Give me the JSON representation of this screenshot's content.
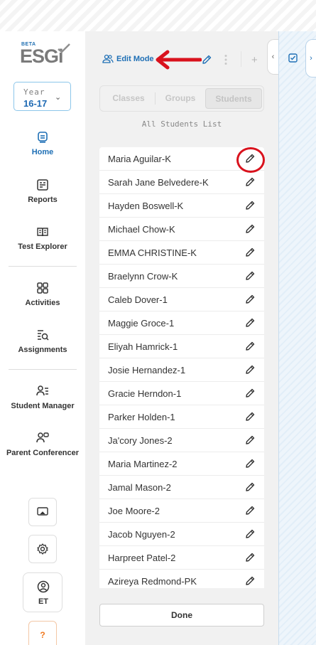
{
  "brand": {
    "beta": "BETA",
    "logo_text": "ESGi"
  },
  "year_selector": {
    "label": "Year",
    "value": "16-17"
  },
  "nav": [
    {
      "label": "Home",
      "icon": "home-icon",
      "active": true
    },
    {
      "label": "Reports",
      "icon": "reports-icon"
    },
    {
      "label": "Test Explorer",
      "icon": "test-explorer-icon"
    },
    {
      "label": "Activities",
      "icon": "activities-icon"
    },
    {
      "label": "Assignments",
      "icon": "assignments-icon"
    },
    {
      "label": "Student Manager",
      "icon": "student-manager-icon"
    },
    {
      "label": "Parent Conferencer",
      "icon": "parent-conferencer-icon"
    }
  ],
  "profile": {
    "initials": "ET"
  },
  "help": {
    "label": "?"
  },
  "panel": {
    "edit_mode_label": "Edit Mode",
    "tabs": [
      "Classes",
      "Groups",
      "Students"
    ],
    "active_tab": "Students",
    "list_title": "All Students List",
    "students": [
      "Maria Aguilar-K",
      "Sarah Jane Belvedere-K",
      "Hayden Boswell-K",
      "Michael Chow-K",
      "EMMA CHRISTINE-K",
      "Braelynn Crow-K",
      "Caleb Dover-1",
      "Maggie Groce-1",
      "Eliyah Hamrick-1",
      "Josie Hernandez-1",
      "Gracie Herndon-1",
      "Parker Holden-1",
      "Ja'cory Jones-2",
      "Maria Martinez-2",
      "Jamal Mason-2",
      "Joe Moore-2",
      "Jacob Nguyen-2",
      "Harpreet Patel-2",
      "Azireya Redmond-PK"
    ],
    "done_label": "Done"
  },
  "colors": {
    "accent": "#1e6fb5",
    "annotation": "#d9121d",
    "warning": "#f07a22"
  }
}
